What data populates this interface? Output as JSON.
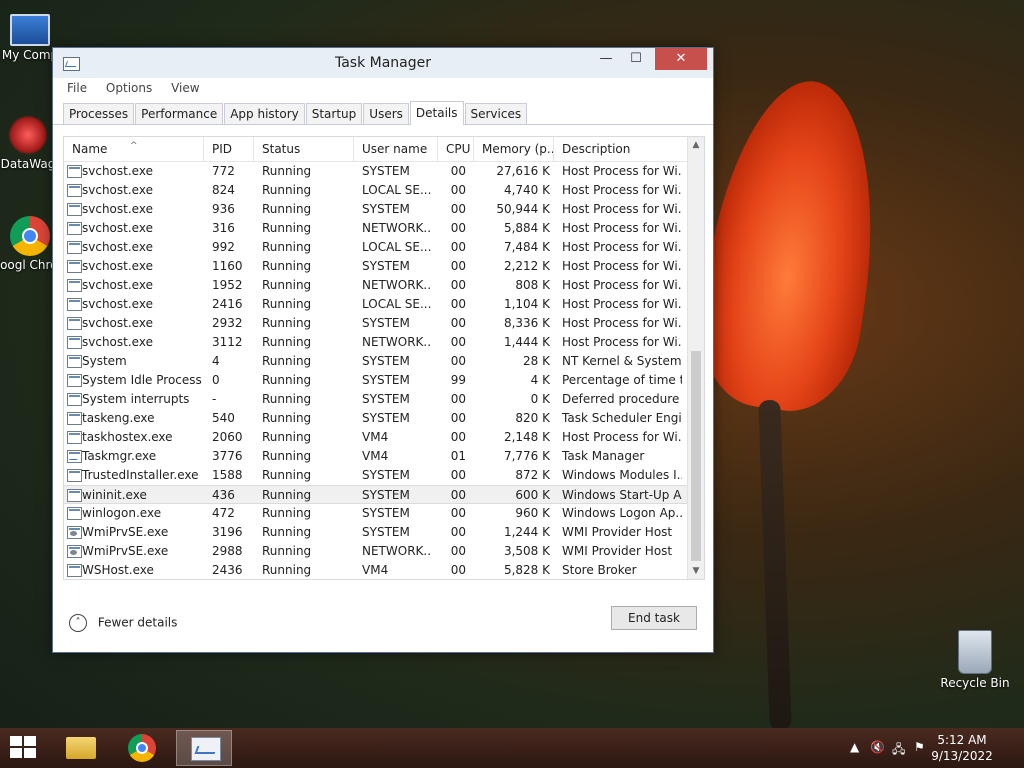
{
  "desktop": {
    "icons": [
      {
        "label": "My Comp"
      },
      {
        "label": "DataWag"
      },
      {
        "label": "Googl Chrom"
      },
      {
        "label": "Recycle Bin"
      }
    ]
  },
  "window": {
    "title": "Task Manager",
    "controls": {
      "minimize": "—",
      "maximize": "☐",
      "close": "✕"
    }
  },
  "menu": [
    "File",
    "Options",
    "View"
  ],
  "tabs": [
    {
      "label": "Processes",
      "active": false
    },
    {
      "label": "Performance",
      "active": false
    },
    {
      "label": "App history",
      "active": false
    },
    {
      "label": "Startup",
      "active": false
    },
    {
      "label": "Users",
      "active": false
    },
    {
      "label": "Details",
      "active": true
    },
    {
      "label": "Services",
      "active": false
    }
  ],
  "table": {
    "columns": [
      "Name",
      "PID",
      "Status",
      "User name",
      "CPU",
      "Memory (p...",
      "Description"
    ],
    "sort_indicator": "^",
    "rows": [
      {
        "name": "svchost.exe",
        "pid": "772",
        "status": "Running",
        "user": "SYSTEM",
        "cpu": "00",
        "mem": "27,616 K",
        "desc": "Host Process for Wi...",
        "icon": "process-icon"
      },
      {
        "name": "svchost.exe",
        "pid": "824",
        "status": "Running",
        "user": "LOCAL SE...",
        "cpu": "00",
        "mem": "4,740 K",
        "desc": "Host Process for Wi...",
        "icon": "process-icon"
      },
      {
        "name": "svchost.exe",
        "pid": "936",
        "status": "Running",
        "user": "SYSTEM",
        "cpu": "00",
        "mem": "50,944 K",
        "desc": "Host Process for Wi...",
        "icon": "process-icon"
      },
      {
        "name": "svchost.exe",
        "pid": "316",
        "status": "Running",
        "user": "NETWORK...",
        "cpu": "00",
        "mem": "5,884 K",
        "desc": "Host Process for Wi...",
        "icon": "process-icon"
      },
      {
        "name": "svchost.exe",
        "pid": "992",
        "status": "Running",
        "user": "LOCAL SE...",
        "cpu": "00",
        "mem": "7,484 K",
        "desc": "Host Process for Wi...",
        "icon": "process-icon"
      },
      {
        "name": "svchost.exe",
        "pid": "1160",
        "status": "Running",
        "user": "SYSTEM",
        "cpu": "00",
        "mem": "2,212 K",
        "desc": "Host Process for Wi...",
        "icon": "process-icon"
      },
      {
        "name": "svchost.exe",
        "pid": "1952",
        "status": "Running",
        "user": "NETWORK...",
        "cpu": "00",
        "mem": "808 K",
        "desc": "Host Process for Wi...",
        "icon": "process-icon"
      },
      {
        "name": "svchost.exe",
        "pid": "2416",
        "status": "Running",
        "user": "LOCAL SE...",
        "cpu": "00",
        "mem": "1,104 K",
        "desc": "Host Process for Wi...",
        "icon": "process-icon"
      },
      {
        "name": "svchost.exe",
        "pid": "2932",
        "status": "Running",
        "user": "SYSTEM",
        "cpu": "00",
        "mem": "8,336 K",
        "desc": "Host Process for Wi...",
        "icon": "process-icon"
      },
      {
        "name": "svchost.exe",
        "pid": "3112",
        "status": "Running",
        "user": "NETWORK...",
        "cpu": "00",
        "mem": "1,444 K",
        "desc": "Host Process for Wi...",
        "icon": "process-icon"
      },
      {
        "name": "System",
        "pid": "4",
        "status": "Running",
        "user": "SYSTEM",
        "cpu": "00",
        "mem": "28 K",
        "desc": "NT Kernel & System",
        "icon": "process-icon"
      },
      {
        "name": "System Idle Process",
        "pid": "0",
        "status": "Running",
        "user": "SYSTEM",
        "cpu": "99",
        "mem": "4 K",
        "desc": "Percentage of time t...",
        "icon": "process-icon"
      },
      {
        "name": "System interrupts",
        "pid": "-",
        "status": "Running",
        "user": "SYSTEM",
        "cpu": "00",
        "mem": "0 K",
        "desc": "Deferred procedure ...",
        "icon": "process-icon"
      },
      {
        "name": "taskeng.exe",
        "pid": "540",
        "status": "Running",
        "user": "SYSTEM",
        "cpu": "00",
        "mem": "820 K",
        "desc": "Task Scheduler Engi...",
        "icon": "process-icon"
      },
      {
        "name": "taskhostex.exe",
        "pid": "2060",
        "status": "Running",
        "user": "VM4",
        "cpu": "00",
        "mem": "2,148 K",
        "desc": "Host Process for Wi...",
        "icon": "process-icon"
      },
      {
        "name": "Taskmgr.exe",
        "pid": "3776",
        "status": "Running",
        "user": "VM4",
        "cpu": "01",
        "mem": "7,776 K",
        "desc": "Task Manager",
        "icon": "task-manager-icon"
      },
      {
        "name": "TrustedInstaller.exe",
        "pid": "1588",
        "status": "Running",
        "user": "SYSTEM",
        "cpu": "00",
        "mem": "872 K",
        "desc": "Windows Modules I...",
        "icon": "process-icon"
      },
      {
        "name": "wininit.exe",
        "pid": "436",
        "status": "Running",
        "user": "SYSTEM",
        "cpu": "00",
        "mem": "600 K",
        "desc": "Windows Start-Up A...",
        "icon": "process-icon",
        "selected": true
      },
      {
        "name": "winlogon.exe",
        "pid": "472",
        "status": "Running",
        "user": "SYSTEM",
        "cpu": "00",
        "mem": "960 K",
        "desc": "Windows Logon Ap...",
        "icon": "process-icon"
      },
      {
        "name": "WmiPrvSE.exe",
        "pid": "3196",
        "status": "Running",
        "user": "SYSTEM",
        "cpu": "00",
        "mem": "1,244 K",
        "desc": "WMI Provider Host",
        "icon": "gear-process-icon"
      },
      {
        "name": "WmiPrvSE.exe",
        "pid": "2988",
        "status": "Running",
        "user": "NETWORK...",
        "cpu": "00",
        "mem": "3,508 K",
        "desc": "WMI Provider Host",
        "icon": "gear-process-icon"
      },
      {
        "name": "WSHost.exe",
        "pid": "2436",
        "status": "Running",
        "user": "VM4",
        "cpu": "00",
        "mem": "5,828 K",
        "desc": "Store Broker",
        "icon": "process-icon"
      }
    ]
  },
  "footer": {
    "fewer_details": "Fewer details",
    "end_task": "End task"
  },
  "taskbar": {
    "time": "5:12 AM",
    "date": "9/13/2022"
  },
  "colors": {
    "close_button": "#c7504c",
    "selected_row": "#f0f0f0"
  }
}
